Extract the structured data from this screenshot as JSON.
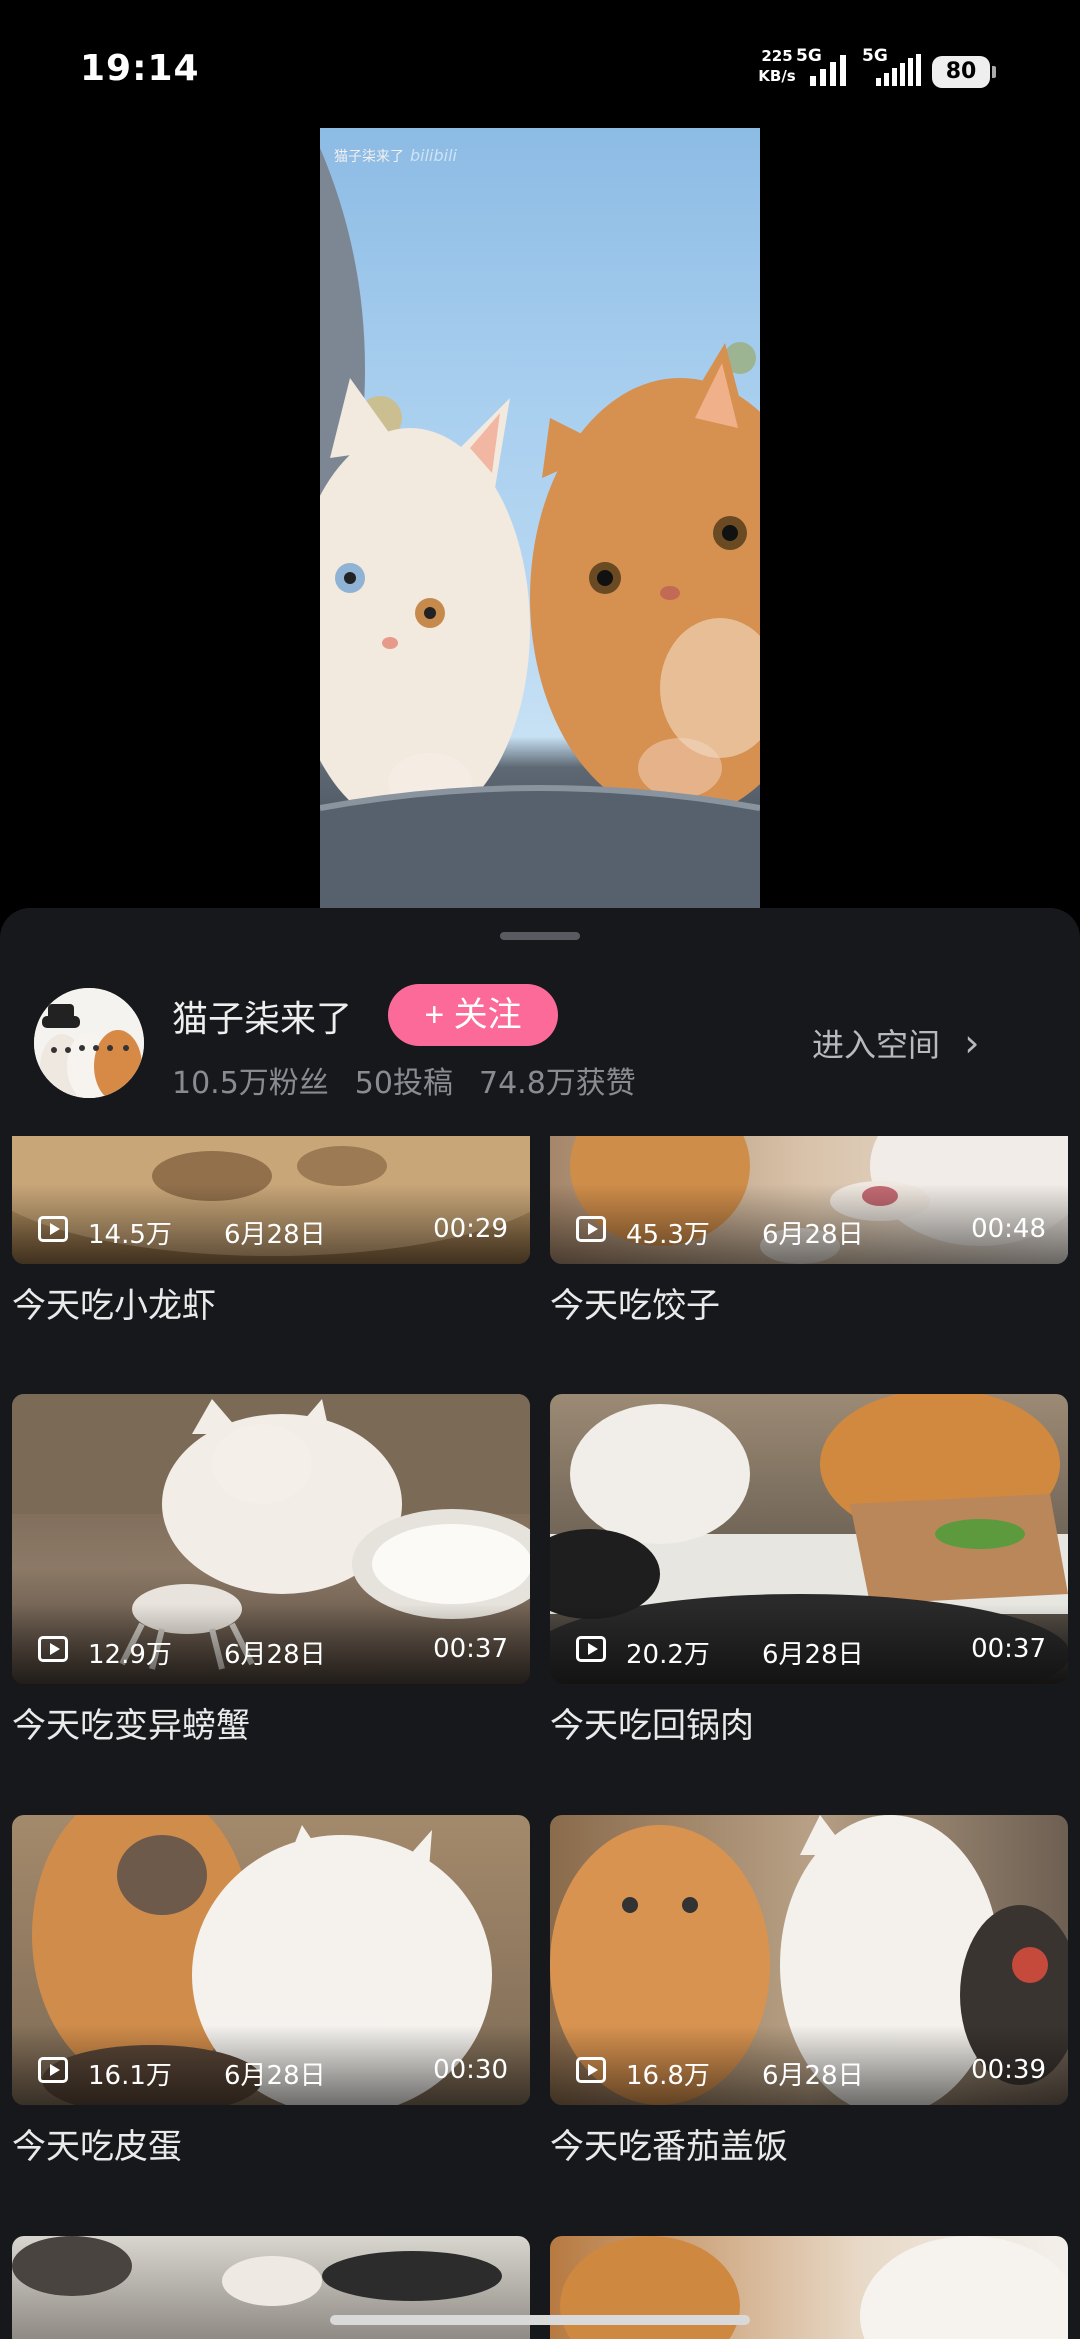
{
  "status_bar": {
    "time": "19:14",
    "net_speed_value": "225",
    "net_speed_unit": "KB/s",
    "sim1": "5G",
    "sim2": "5G",
    "battery": "80"
  },
  "video": {
    "watermark_channel": "猫子柒来了",
    "watermark_brand": "bilibili"
  },
  "uploader": {
    "name": "猫子柒来了",
    "follow_label": "+ 关注",
    "fans": "10.5万粉丝",
    "posts": "50投稿",
    "likes": "74.8万获赞",
    "space_label": "进入空间",
    "space_chevron": "›"
  },
  "videos": [
    {
      "views": "14.5万",
      "date": "6月28日",
      "duration": "00:29",
      "title": "今天吃小龙虾"
    },
    {
      "views": "45.3万",
      "date": "6月28日",
      "duration": "00:48",
      "title": "今天吃饺子"
    },
    {
      "views": "12.9万",
      "date": "6月28日",
      "duration": "00:37",
      "title": "今天吃变异螃蟹"
    },
    {
      "views": "20.2万",
      "date": "6月28日",
      "duration": "00:37",
      "title": "今天吃回锅肉"
    },
    {
      "views": "16.1万",
      "date": "6月28日",
      "duration": "00:30",
      "title": "今天吃皮蛋"
    },
    {
      "views": "16.8万",
      "date": "6月28日",
      "duration": "00:39",
      "title": "今天吃番茄盖饭"
    }
  ],
  "colors": {
    "follow_button": "#fb6a99",
    "sheet_background": "#17181b",
    "secondary_text": "#8a8b90"
  }
}
